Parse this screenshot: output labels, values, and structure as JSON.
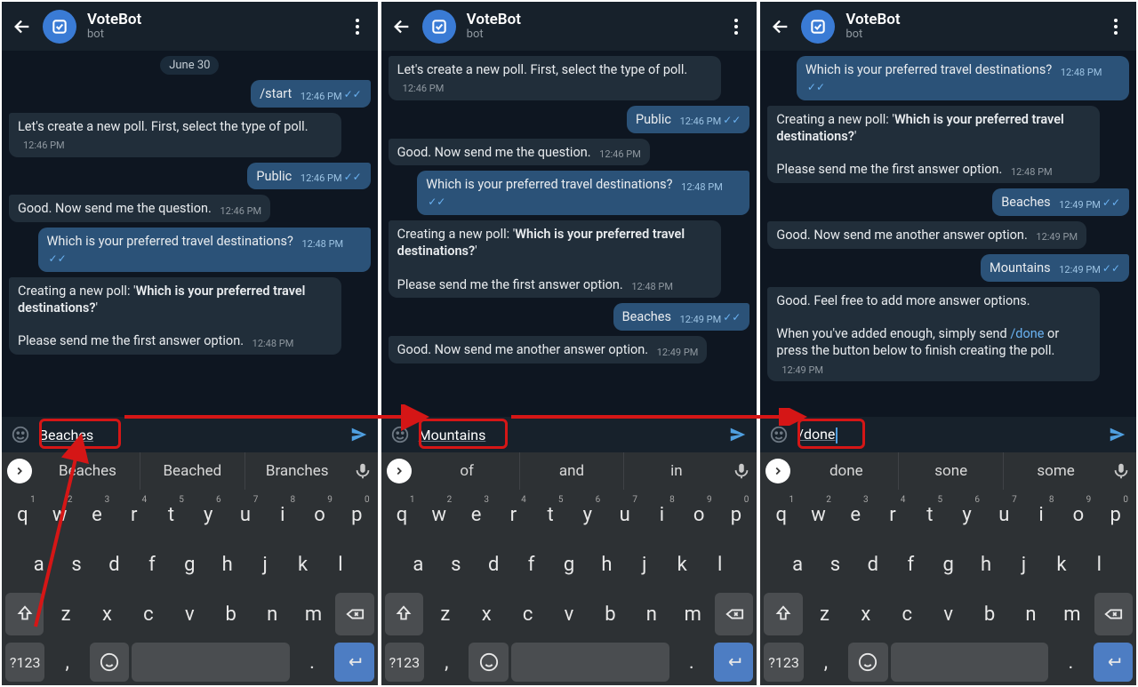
{
  "header": {
    "title": "VoteBot",
    "subtitle": "bot"
  },
  "date_pill": "June 30",
  "times": {
    "a": "12:46 PM",
    "b": "12:48 PM",
    "c": "12:49 PM"
  },
  "bot": {
    "create": "Let's create a new poll. First, select the type of poll.",
    "good_q": "Good. Now send me the question.",
    "creating_pre": "Creating a new poll: '",
    "creating_q": "Which is your preferred travel destinations?",
    "creating_post": "'",
    "first_opt": "Please send me the first answer option.",
    "another": "Good. Now send me another answer option.",
    "feel_free": "Good. Feel free to add more answer options.",
    "done_hint_pre": "When you've added enough, simply send ",
    "done_cmd": "/done",
    "done_hint_post": " or press the button below to finish creating the poll.",
    "truncated": "Which is your preferred travel destinations?"
  },
  "user": {
    "start": "/start",
    "public": "Public",
    "question": "Which is your preferred travel destinations?",
    "beaches": "Beaches",
    "mountains": "Mountains"
  },
  "input": {
    "p1": "Beaches",
    "p2": "Mountains",
    "p3": "/done"
  },
  "suggest": {
    "p1": [
      "Beaches",
      "Beached",
      "Branches"
    ],
    "p2": [
      "of",
      "and",
      "in"
    ],
    "p3": [
      "done",
      "sone",
      "some"
    ]
  },
  "kb": {
    "row1": [
      "q",
      "w",
      "e",
      "r",
      "t",
      "y",
      "u",
      "i",
      "o",
      "p"
    ],
    "digits": [
      "1",
      "2",
      "3",
      "4",
      "5",
      "6",
      "7",
      "8",
      "9",
      "0"
    ],
    "row2": [
      "a",
      "s",
      "d",
      "f",
      "g",
      "h",
      "j",
      "k",
      "l"
    ],
    "row3": [
      "z",
      "x",
      "c",
      "v",
      "b",
      "n",
      "m"
    ],
    "sym": "?123",
    "comma": ",",
    "period": "."
  }
}
